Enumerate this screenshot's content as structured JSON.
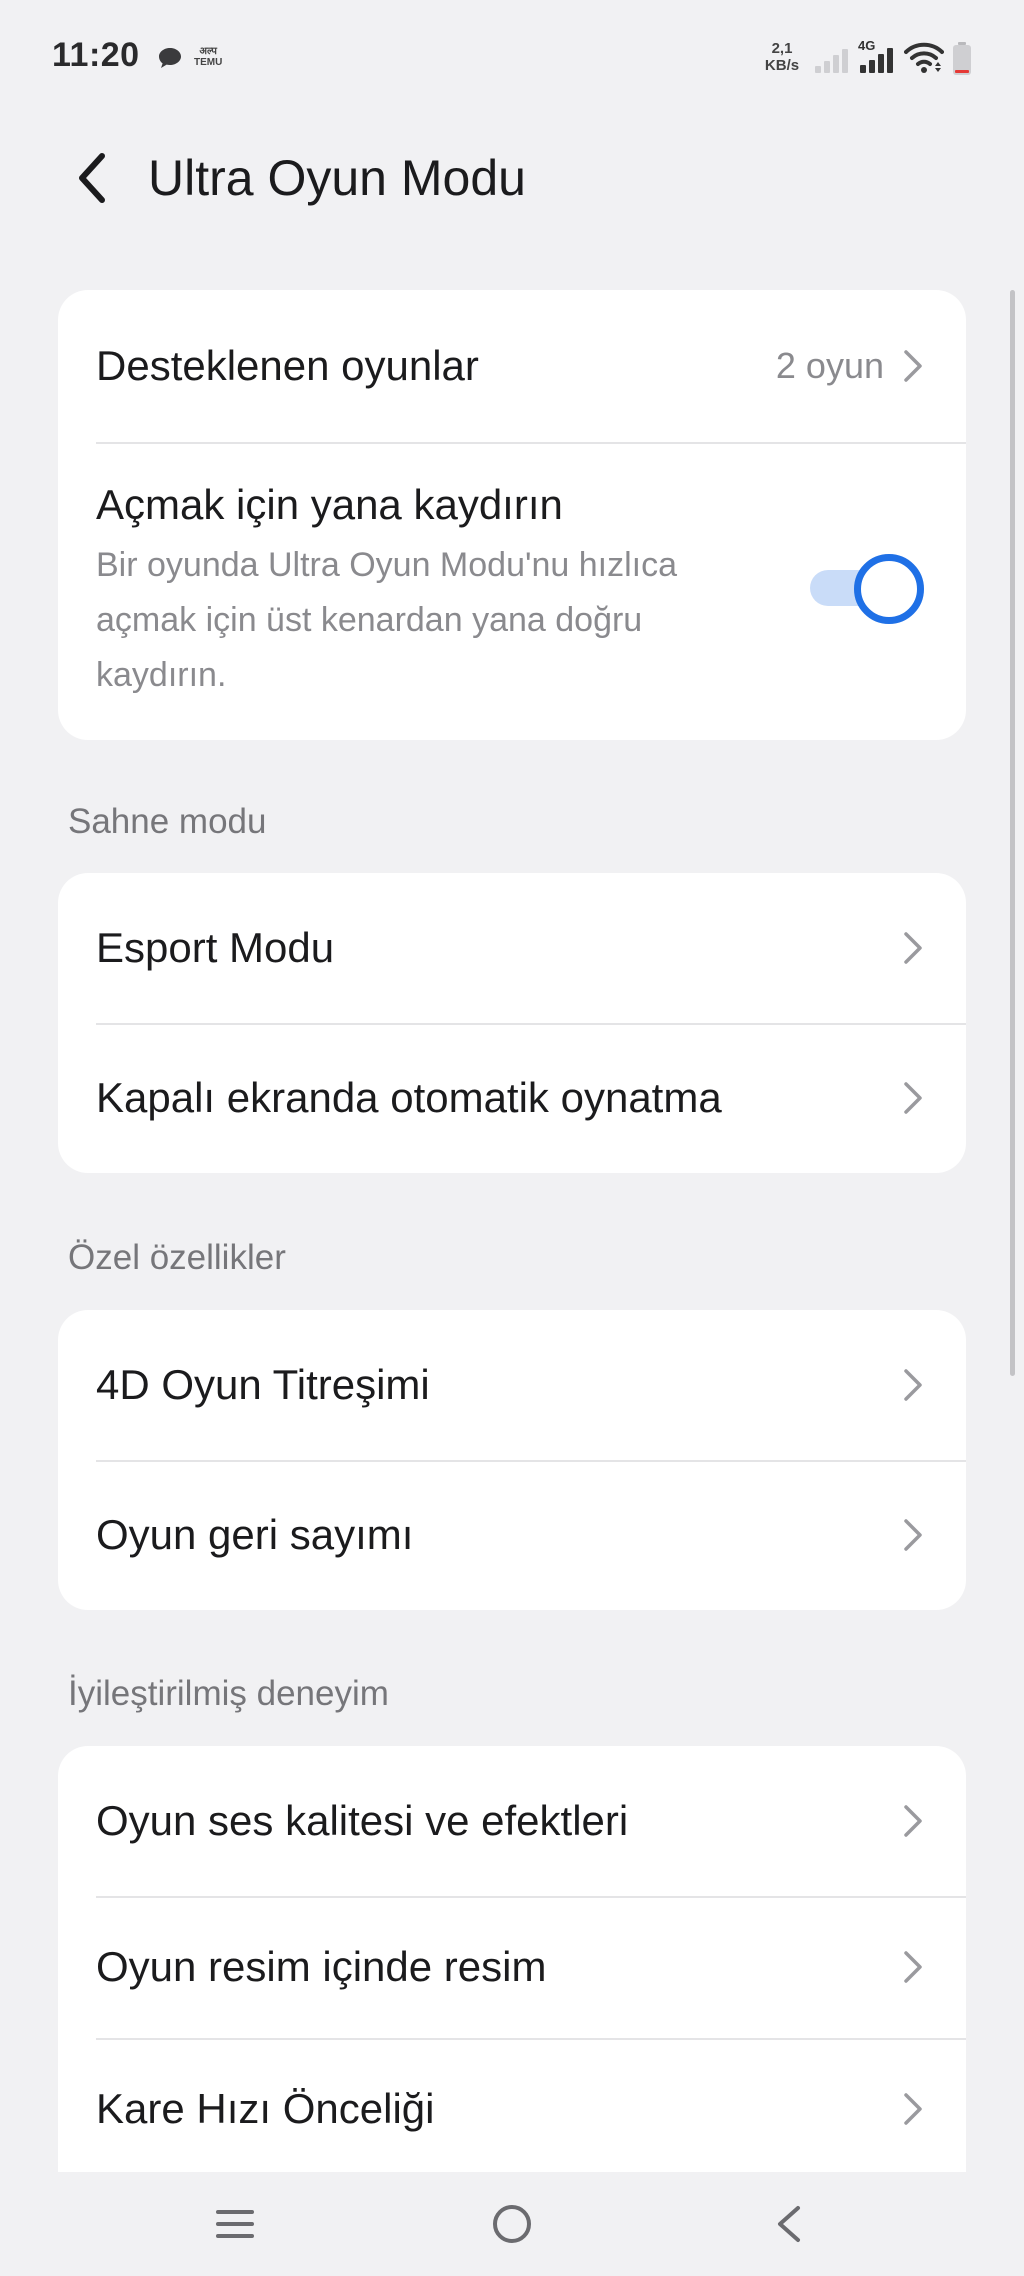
{
  "status_bar": {
    "time": "11:20",
    "temu_top": "अल्प",
    "temu_bottom": "TEMU",
    "net_speed_value": "2,1",
    "net_speed_unit": "KB/s",
    "network_type": "4G",
    "icons": [
      "chat-bubble-icon",
      "temu-app-icon",
      "signal-weak-icon",
      "signal-strong-icon",
      "wifi-icon",
      "battery-low-icon"
    ]
  },
  "header": {
    "title": "Ultra Oyun Modu",
    "back_icon": "chevron-left-icon"
  },
  "top_card": {
    "supported_games_label": "Desteklenen oyunlar",
    "supported_games_value": "2 oyun",
    "swipe_title": "Açmak için yana kaydırın",
    "swipe_desc_line1": "Bir oyunda Ultra Oyun Modu'nu hızlıca",
    "swipe_desc_line2": "açmak için üst kenardan yana doğru",
    "swipe_desc_line3": "kaydırın.",
    "swipe_toggle_on": true
  },
  "sections": {
    "scene_mode": {
      "header": "Sahne modu",
      "items": [
        "Esport Modu",
        "Kapalı ekranda otomatik oynatma"
      ]
    },
    "special_features": {
      "header": "Özel özellikler",
      "items": [
        "4D Oyun Titreşimi",
        "Oyun geri sayımı"
      ]
    },
    "enhanced_experience": {
      "header": "İyileştirilmiş deneyim",
      "items": [
        "Oyun ses kalitesi ve efektleri",
        "Oyun resim içinde resim",
        "Kare Hızı Önceliği"
      ]
    }
  },
  "nav_bar": {
    "icons": [
      "menu-icon",
      "home-circle-icon",
      "back-triangle-icon"
    ]
  },
  "colors": {
    "background": "#f1f1f3",
    "card": "#ffffff",
    "accent": "#1f70e6",
    "secondary_text": "#8a8a8e"
  }
}
